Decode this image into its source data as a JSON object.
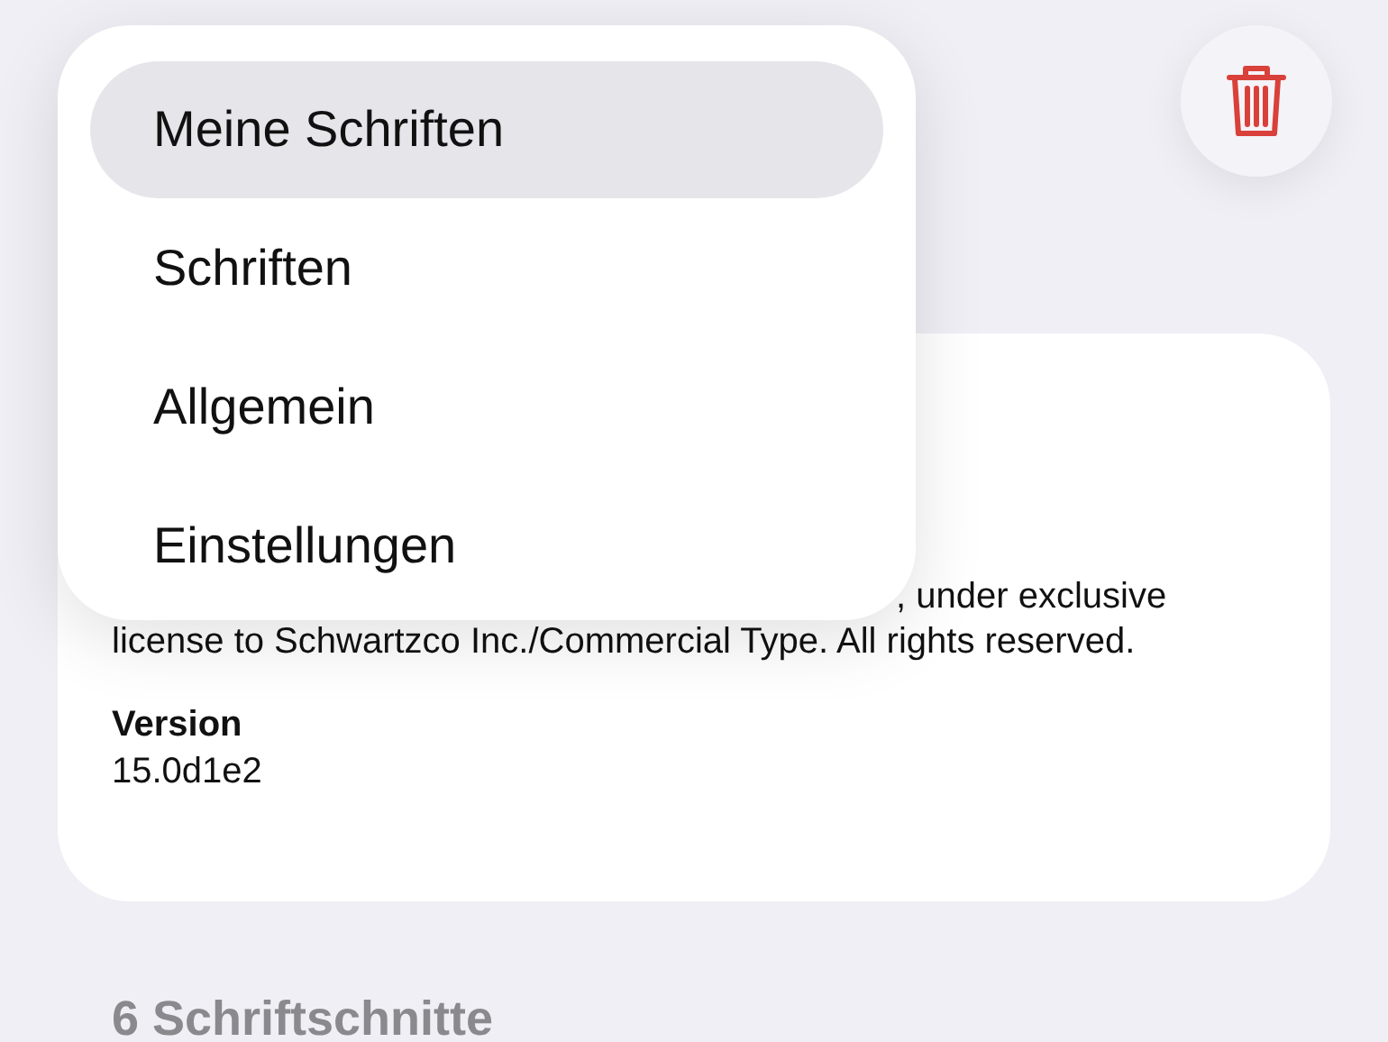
{
  "menu": {
    "items": [
      {
        "label": "Meine Schriften",
        "selected": true
      },
      {
        "label": "Schriften",
        "selected": false
      },
      {
        "label": "Allgemein",
        "selected": false
      },
      {
        "label": "Einstellungen",
        "selected": false
      }
    ]
  },
  "delete_button": {
    "kind": "trash"
  },
  "info_card": {
    "copyright_fragment": ", under exclusive",
    "copyright_line": "license to Schwartzco Inc./Commercial Type. All rights reserved.",
    "version_label": "Version",
    "version_value": "15.0d1e2"
  },
  "styles_header": "6 Schriftschnitte"
}
